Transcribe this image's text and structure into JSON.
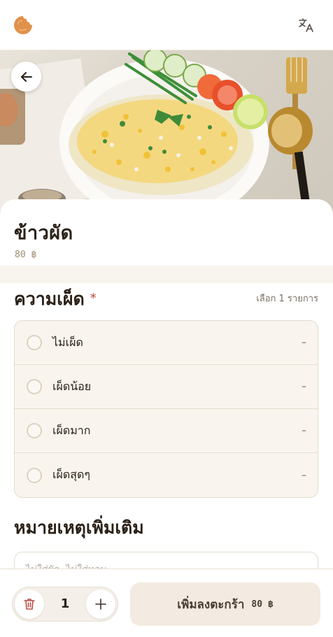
{
  "header": {
    "logo_icon": "bitten-cookie-logo-icon",
    "language_icon": "translate-icon",
    "brand_color": "#e0914a"
  },
  "hero": {
    "image_icon": "fried-rice-photo",
    "back_icon": "arrow-left-icon"
  },
  "product": {
    "name": "ข้าวผัด",
    "price": "80 ฿"
  },
  "spiciness": {
    "title": "ความเผ็ด",
    "required_mark": "*",
    "hint": "เลือก 1 รายการ",
    "options": [
      {
        "label": "ไม่เผ็ด",
        "price": "–"
      },
      {
        "label": "เผ็ดน้อย",
        "price": "–"
      },
      {
        "label": "เผ็ดมาก",
        "price": "–"
      },
      {
        "label": "เผ็ดสุดๆ",
        "price": "–"
      }
    ]
  },
  "notes": {
    "title": "หมายเหตุเพิ่มเติม",
    "placeholder": "ไม่ใส่ผัก, ไม่ใส่หอม..."
  },
  "cart": {
    "quantity": "1",
    "add_label": "เพิ่มลงตะกร้า",
    "add_price": "80 ฿",
    "trash_icon": "trash-icon",
    "plus_icon": "plus-icon"
  }
}
